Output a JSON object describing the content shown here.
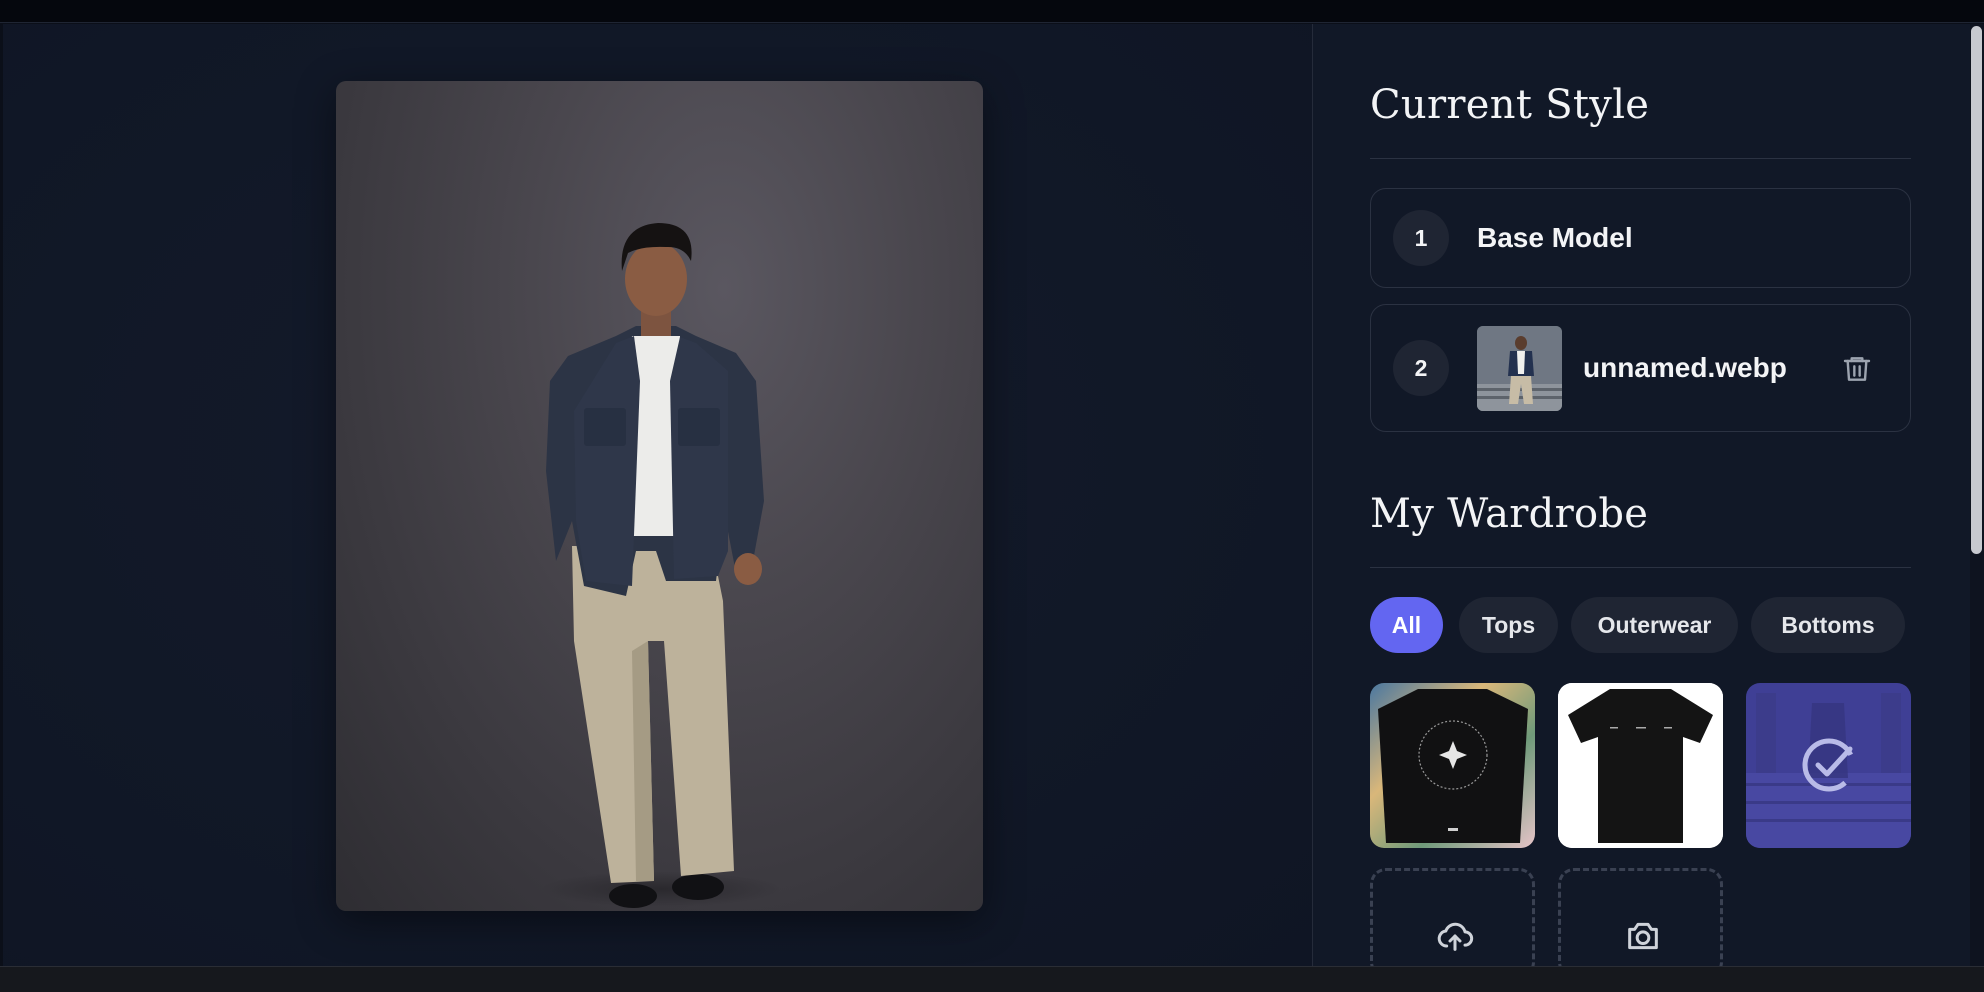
{
  "current_style": {
    "title": "Current Style",
    "layers": [
      {
        "number": "1",
        "label": "Base Model"
      },
      {
        "number": "2",
        "label": "unnamed.webp"
      }
    ]
  },
  "wardrobe": {
    "title": "My Wardrobe",
    "filters": [
      "All",
      "Tops",
      "Outerwear",
      "Bottoms"
    ],
    "active_filter": "All",
    "items": [
      {
        "icon": "black-longsleeve-sparkle-shirt"
      },
      {
        "icon": "black-tshirt"
      },
      {
        "icon": "selected-outfit-check",
        "selected": true
      }
    ],
    "actions": [
      {
        "icon": "cloud-upload-icon"
      },
      {
        "icon": "camera-icon"
      }
    ]
  },
  "colors": {
    "accent": "#6366f1",
    "panel_bg": "#111827",
    "card_border": "#2b3242",
    "chip_bg": "#1f2533"
  }
}
